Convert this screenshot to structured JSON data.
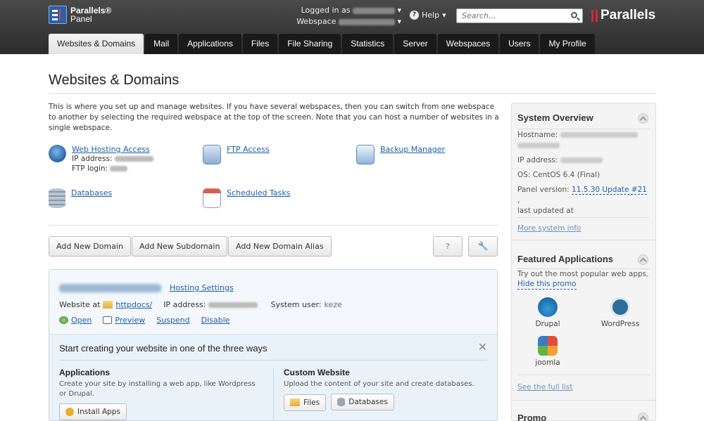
{
  "header": {
    "logo_line1": "Parallels®",
    "logo_line2": "Panel",
    "logged_in_label": "Logged in as",
    "webspace_label": "Webspace",
    "help_label": "Help",
    "search_placeholder": "Search...",
    "brand": "Parallels"
  },
  "tabs": [
    {
      "label": "Websites & Domains",
      "active": true
    },
    {
      "label": "Mail"
    },
    {
      "label": "Applications"
    },
    {
      "label": "Files"
    },
    {
      "label": "File Sharing"
    },
    {
      "label": "Statistics"
    },
    {
      "label": "Server"
    },
    {
      "label": "Webspaces"
    },
    {
      "label": "Users"
    },
    {
      "label": "My Profile"
    }
  ],
  "page": {
    "title": "Websites & Domains",
    "intro": "This is where you set up and manage websites. If you have several webspaces, then you can switch from one webspace to another by selecting the required webspace at the top of the screen. Note that you can host a number of websites in a single webspace."
  },
  "shortcuts": {
    "web_hosting": "Web Hosting Access",
    "ip_label": "IP address:",
    "ftp_login_label": "FTP login:",
    "ftp_access": "FTP Access",
    "backup": "Backup Manager",
    "databases": "Databases",
    "tasks": "Scheduled Tasks"
  },
  "buttons": {
    "add_domain": "Add New Domain",
    "add_subdomain": "Add New Subdomain",
    "add_alias": "Add New Domain Alias",
    "help": "?",
    "tools": "🔧"
  },
  "domain": {
    "hosting_settings": "Hosting Settings",
    "website_at": "Website at",
    "docroot": "httpdocs/",
    "ip_label": "IP address:",
    "system_user_label": "System user:",
    "system_user": "keze",
    "actions": [
      "Open",
      "Preview",
      "Suspend",
      "Disable"
    ]
  },
  "start": {
    "title": "Start creating your website in one of the three ways",
    "close": "✕",
    "apps_title": "Applications",
    "apps_desc": "Create your site by installing a web app, like Wordpress or Drupal.",
    "apps_button": "Install Apps",
    "custom_title": "Custom Website",
    "custom_desc": "Upload the content of your site and create databases.",
    "files_button": "Files",
    "db_button": "Databases"
  },
  "sidebar": {
    "overview_title": "System Overview",
    "hostname_label": "Hostname:",
    "ip_label": "IP address:",
    "os": "OS: CentOS 6.4 (Final)",
    "panel_version_label": "Panel version:",
    "panel_version": "11.5.30 Update #21",
    "last_updated": "last updated at",
    "more_info": "More system info",
    "featured_title": "Featured Applications",
    "featured_desc": "Try out the most popular web apps.",
    "hide_promo": "Hide this promo",
    "apps": [
      "Drupal",
      "WordPress",
      "joomla"
    ],
    "full_list": "See the full list",
    "promo_title": "Promo"
  },
  "colors": {
    "link": "#1e5ea8",
    "header_bg": "#2c2c2c",
    "brand_red": "#d7263d"
  }
}
